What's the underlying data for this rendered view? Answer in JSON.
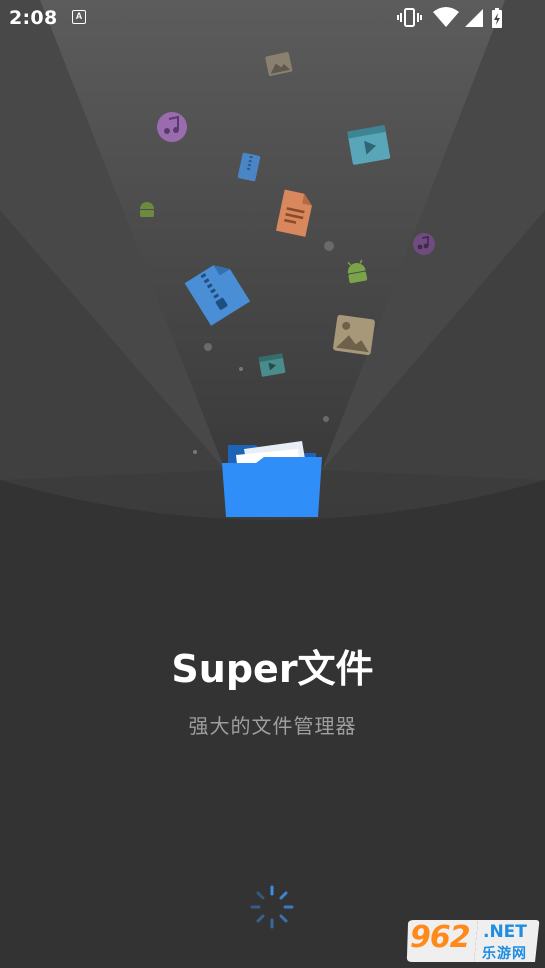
{
  "status_bar": {
    "time": "2:08",
    "notification_letter": "A",
    "icons": [
      "vibrate-icon",
      "wifi-icon",
      "signal-icon",
      "battery-charging-icon"
    ]
  },
  "splash": {
    "title": "Super文件",
    "subtitle": "强大的文件管理器",
    "center_icon": "folder-icon",
    "floating_icons": [
      "image-icon",
      "music-icon",
      "video-icon",
      "zip-icon",
      "android-icon",
      "document-icon",
      "image-icon",
      "video-icon",
      "music-icon"
    ],
    "loading_indicator": "loading-spinner"
  },
  "watermark": {
    "number": "962",
    "suffix": ".NET",
    "site_name": "乐游网"
  },
  "colors": {
    "background": "#333333",
    "folder_blue": "#2f8ef7",
    "spinner_blue": "#3b8fe6",
    "title_text": "#ffffff",
    "subtitle_text": "#9e9e9e"
  }
}
